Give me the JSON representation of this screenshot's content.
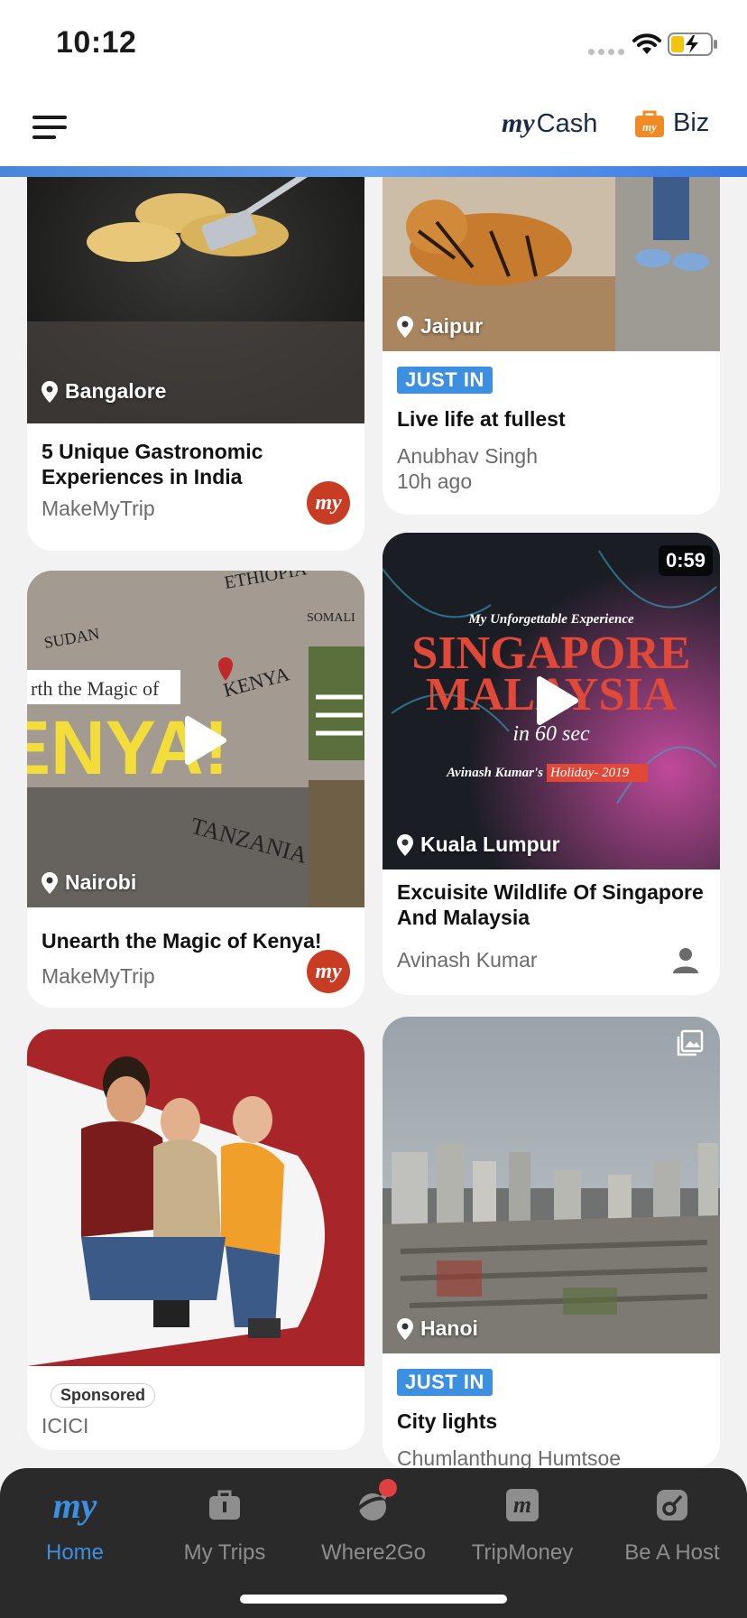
{
  "status": {
    "time": "10:12"
  },
  "header": {
    "mycash_prefix": "my",
    "mycash_label": "Cash",
    "biz_label": "Biz",
    "biz_icon_text": "my"
  },
  "feed": {
    "bangalore": {
      "location": "Bangalore",
      "title": "5 Unique Gastronomic Experiences in India",
      "author": "MakeMyTrip",
      "logo": "my"
    },
    "jaipur": {
      "location": "Jaipur",
      "badge": "JUST IN",
      "title": "Live life at fullest",
      "author": "Anubhav Singh",
      "ago": "10h ago"
    },
    "nairobi": {
      "location": "Nairobi",
      "title": "Unearth the Magic of Kenya!",
      "author": "MakeMyTrip",
      "logo": "my",
      "overlay_line": "rth the Magic of",
      "overlay_big": "ENYA!",
      "map_kenya": "KENYA",
      "map_sudan": "SUDAN",
      "map_ethiopia": "ETHIOPIA",
      "map_tanzania": "TANZANIA",
      "map_somalia": "SOMALI"
    },
    "kl": {
      "location": "Kuala Lumpur",
      "duration": "0:59",
      "title": "Excuisite Wildlife Of Singapore And Malaysia",
      "author": "Avinash Kumar",
      "thumb_top": "My Unforgettable Experience",
      "thumb_line1": "SINGAPORE",
      "thumb_line2": "MALAYSIA",
      "thumb_sub": "in 60 sec",
      "thumb_credit": "Avinash Kumar's",
      "thumb_credit_hl": "Holiday- 2019"
    },
    "icici": {
      "sponsored": "Sponsored",
      "author": "ICICI"
    },
    "hanoi": {
      "location": "Hanoi",
      "badge": "JUST IN",
      "title": "City lights",
      "author": "Chumlanthung Humtsoe"
    }
  },
  "nav": {
    "tabs": [
      {
        "label": "Home",
        "icon": "my"
      },
      {
        "label": "My Trips"
      },
      {
        "label": "Where2Go"
      },
      {
        "label": "TripMoney",
        "icon": "m"
      },
      {
        "label": "Be A Host"
      }
    ]
  },
  "colors": {
    "accent": "#3d8fe0",
    "brand_red": "#c93c24",
    "nav_bg": "#2a2a2a"
  }
}
